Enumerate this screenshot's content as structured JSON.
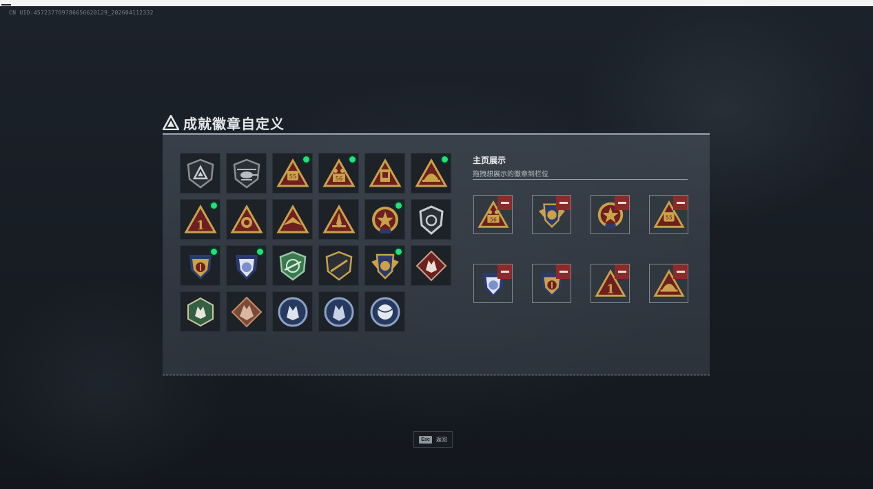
{
  "header": {
    "uid_text": "CN UID:457237709786656620129_202604112332"
  },
  "panel": {
    "title": "成就徽章自定义"
  },
  "badges": [
    {
      "icon": "shield-triangle-badge-icon",
      "new": false
    },
    {
      "icon": "helicopter-shield-badge-icon",
      "new": false
    },
    {
      "icon": "triangle-55-badge-icon",
      "new": true
    },
    {
      "icon": "triangle-56-badge-icon",
      "new": true
    },
    {
      "icon": "triangle-tower-badge-icon",
      "new": false
    },
    {
      "icon": "triangle-helmet-badge-icon",
      "new": true
    },
    {
      "icon": "triangle-rank1-badge-icon",
      "new": true
    },
    {
      "icon": "triangle-lion-badge-icon",
      "new": false
    },
    {
      "icon": "triangle-wings-badge-icon",
      "new": false
    },
    {
      "icon": "triangle-rocket-badge-icon",
      "new": false
    },
    {
      "icon": "star-medal-badge-icon",
      "new": true
    },
    {
      "icon": "dark-crest-badge-icon",
      "new": false
    },
    {
      "icon": "blue-gold-crest-badge-icon",
      "new": true
    },
    {
      "icon": "blue-lion-crest-badge-icon",
      "new": true
    },
    {
      "icon": "green-sniper-shield-badge-icon",
      "new": false
    },
    {
      "icon": "dark-rifle-shield-badge-icon",
      "new": false
    },
    {
      "icon": "winged-gold-crest-badge-icon",
      "new": true
    },
    {
      "icon": "wolf-diamond-badge-icon",
      "new": false
    },
    {
      "icon": "green-hex-wolf-badge-icon",
      "new": false
    },
    {
      "icon": "bronze-diamond-dragon-badge-icon",
      "new": false
    },
    {
      "icon": "blue-wolf-circle-badge-icon",
      "new": false
    },
    {
      "icon": "blue-wolf-circle-2-badge-icon",
      "new": false
    },
    {
      "icon": "blue-ball-circle-badge-icon",
      "new": false
    }
  ],
  "showcase": {
    "heading": "主页展示",
    "subheading": "拖拽想展示的徽章到栏位",
    "slots": [
      {
        "icon": "triangle-56-badge-icon"
      },
      {
        "icon": "winged-gold-crest-badge-icon"
      },
      {
        "icon": "star-medal-badge-icon"
      },
      {
        "icon": "triangle-55-badge-icon"
      },
      {
        "icon": "blue-lion-crest-badge-icon"
      },
      {
        "icon": "blue-gold-crest-badge-icon"
      },
      {
        "icon": "triangle-rank1-badge-icon"
      },
      {
        "icon": "triangle-helmet-badge-icon"
      }
    ]
  },
  "footer": {
    "esc_key": "Esc",
    "back_label": "返回"
  },
  "colors": {
    "new_dot": "#22e07a",
    "remove_button": "#8c2a2a",
    "gold": "#c9a24a",
    "maroon": "#6e1f1f"
  }
}
